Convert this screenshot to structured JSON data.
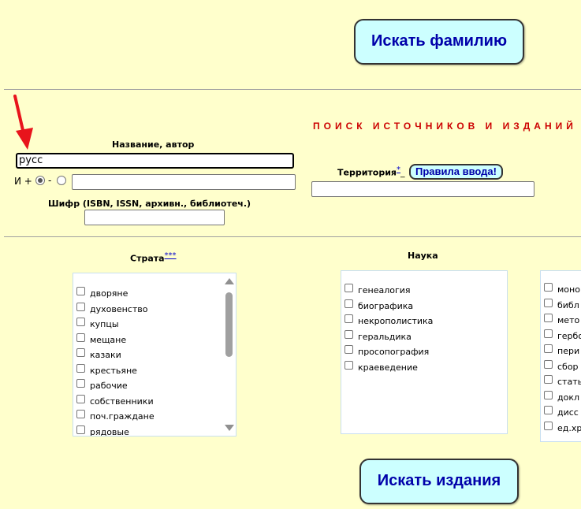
{
  "top_button": {
    "label": "Искать фамилию"
  },
  "heading": {
    "text": "ПОИСК ИСТОЧНИКОВ И ИЗДАНИЙ"
  },
  "title_author": {
    "label": "Название, автор",
    "value": "русс",
    "extra_value": ""
  },
  "logic": {
    "and_label": "И +",
    "minus_label": "-",
    "selected": "and"
  },
  "cipher": {
    "label": "Шифр (ISBN, ISSN, архивн., библиотеч.)",
    "value": ""
  },
  "territory": {
    "label": "Территория",
    "link": "*",
    "link_suffix": "_",
    "value": "",
    "rules_button": "Правила ввода!"
  },
  "strata": {
    "label": "Страта",
    "link": "***",
    "items": [
      "дворяне",
      "духовенство",
      "купцы",
      "мещане",
      "казаки",
      "крестьяне",
      "рабочие",
      "собственники",
      "поч.граждане",
      "рядовые"
    ]
  },
  "science": {
    "label": "Наука",
    "items": [
      "генеалогия",
      "биографика",
      "некрополистика",
      "геральдика",
      "просопография",
      "краеведение"
    ]
  },
  "types": {
    "items": [
      "моно",
      "библ",
      "мето",
      "гербо",
      "пери",
      "сбор",
      "стать",
      "докл",
      "дисс",
      "ед.хр"
    ]
  },
  "bottom_button": {
    "label": "Искать издания"
  },
  "colors": {
    "background": "#ffffcc",
    "button_bg": "#ccffff",
    "button_text": "#0000aa",
    "heading": "#cc0000",
    "arrow": "#e8141c"
  }
}
